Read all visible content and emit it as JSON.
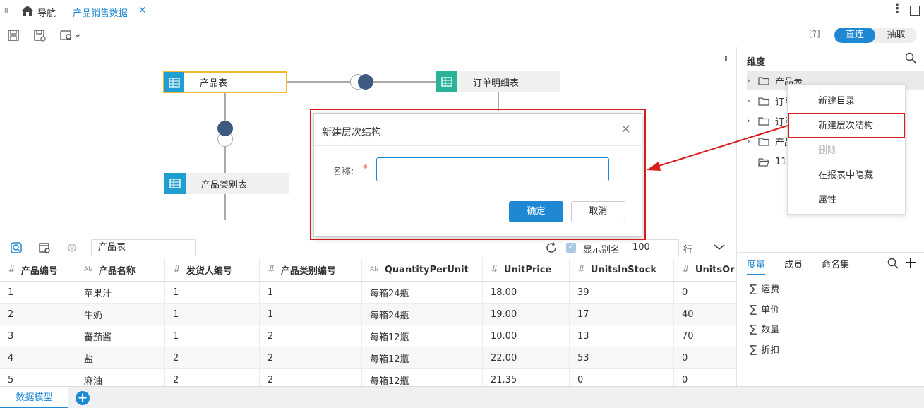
{
  "tabbar": {
    "nav_label": "导航",
    "tab_label": "产品销售数据",
    "close": "✕"
  },
  "toolbar": {
    "help": "[?]",
    "mode_on": "直连",
    "mode_off": "抽取"
  },
  "diagram": {
    "nodes": [
      {
        "label": "产品表"
      },
      {
        "label": "订单明细表"
      },
      {
        "label": "产品类别表"
      }
    ]
  },
  "dialog": {
    "title": "新建层次结构",
    "name_label": "名称:",
    "required": "*",
    "name_value": "",
    "ok": "确定",
    "cancel": "取消"
  },
  "dimension_panel": {
    "title": "维度",
    "items": [
      {
        "label": "产品表"
      },
      {
        "label": "订单"
      },
      {
        "label": "订单"
      },
      {
        "label": "产品"
      },
      {
        "label": "11"
      }
    ]
  },
  "context_menu": {
    "items": [
      {
        "label": "新建目录",
        "disabled": false
      },
      {
        "label": "新建层次结构",
        "disabled": false
      },
      {
        "label": "删除",
        "disabled": true
      },
      {
        "label": "在报表中隐藏",
        "disabled": false
      },
      {
        "label": "属性",
        "disabled": false
      }
    ]
  },
  "measure_panel": {
    "tabs": [
      "度量",
      "成员",
      "命名集"
    ],
    "items": [
      "运费",
      "单价",
      "数量",
      "折扣"
    ]
  },
  "data_bar": {
    "table_name": "产品表",
    "show_alias": "显示别名",
    "rows": "100",
    "rows_unit": "行"
  },
  "grid": {
    "columns": [
      {
        "type": "#",
        "label": "产品编号"
      },
      {
        "type": "Ab",
        "label": "产品名称"
      },
      {
        "type": "#",
        "label": "发货人编号"
      },
      {
        "type": "#",
        "label": "产品类别编号"
      },
      {
        "type": "Ab",
        "label": "QuantityPerUnit"
      },
      {
        "type": "#",
        "label": "UnitPrice"
      },
      {
        "type": "#",
        "label": "UnitsInStock"
      },
      {
        "type": "#",
        "label": "UnitsOr"
      }
    ],
    "rows": [
      [
        "1",
        "苹果汁",
        "1",
        "1",
        "每箱24瓶",
        "18.00",
        "39",
        "0"
      ],
      [
        "2",
        "牛奶",
        "1",
        "1",
        "每箱24瓶",
        "19.00",
        "17",
        "40"
      ],
      [
        "3",
        "蕃茄酱",
        "1",
        "2",
        "每箱12瓶",
        "10.00",
        "13",
        "70"
      ],
      [
        "4",
        "盐",
        "2",
        "2",
        "每箱12瓶",
        "22.00",
        "53",
        "0"
      ],
      [
        "5",
        "麻油",
        "2",
        "2",
        "每箱12瓶",
        "21.35",
        "0",
        "0"
      ]
    ]
  },
  "bottom": {
    "tab": "数据模型",
    "add": "+"
  },
  "colors": {
    "accent": "#1e88d3",
    "highlight": "#d81e1e",
    "node_selected": "#f5b82e"
  }
}
